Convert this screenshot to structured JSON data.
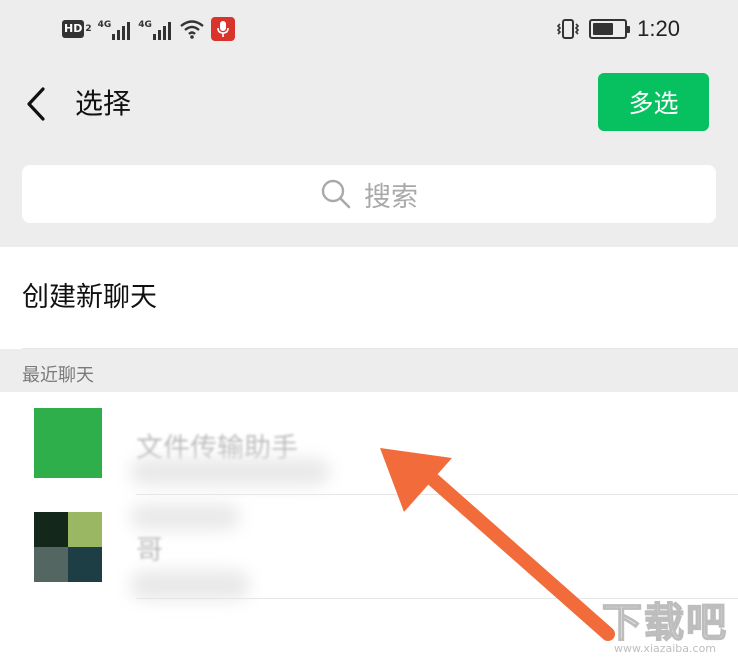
{
  "status_bar": {
    "hd_label": "HD",
    "hd_sub": "2",
    "network_1": "4G",
    "network_2": "4G",
    "time": "1:20",
    "battery_level": 0.65,
    "icons": [
      "hd-icon",
      "signal-icon",
      "signal-icon",
      "wifi-icon",
      "mic-icon",
      "vibrate-icon",
      "battery-icon"
    ]
  },
  "header": {
    "title": "选择",
    "multi_select_label": "多选",
    "accent_color": "#07c160"
  },
  "search": {
    "placeholder": "搜索"
  },
  "create_chat": {
    "label": "创建新聊天"
  },
  "recent_section": {
    "label": "最近聊天"
  },
  "chats": [
    {
      "name": "文件传输助手",
      "avatar": "green-square"
    },
    {
      "name": "哥",
      "avatar": "four-tile"
    }
  ],
  "watermark": {
    "main": "下载吧",
    "sub": "www.xiazaiba.com"
  }
}
